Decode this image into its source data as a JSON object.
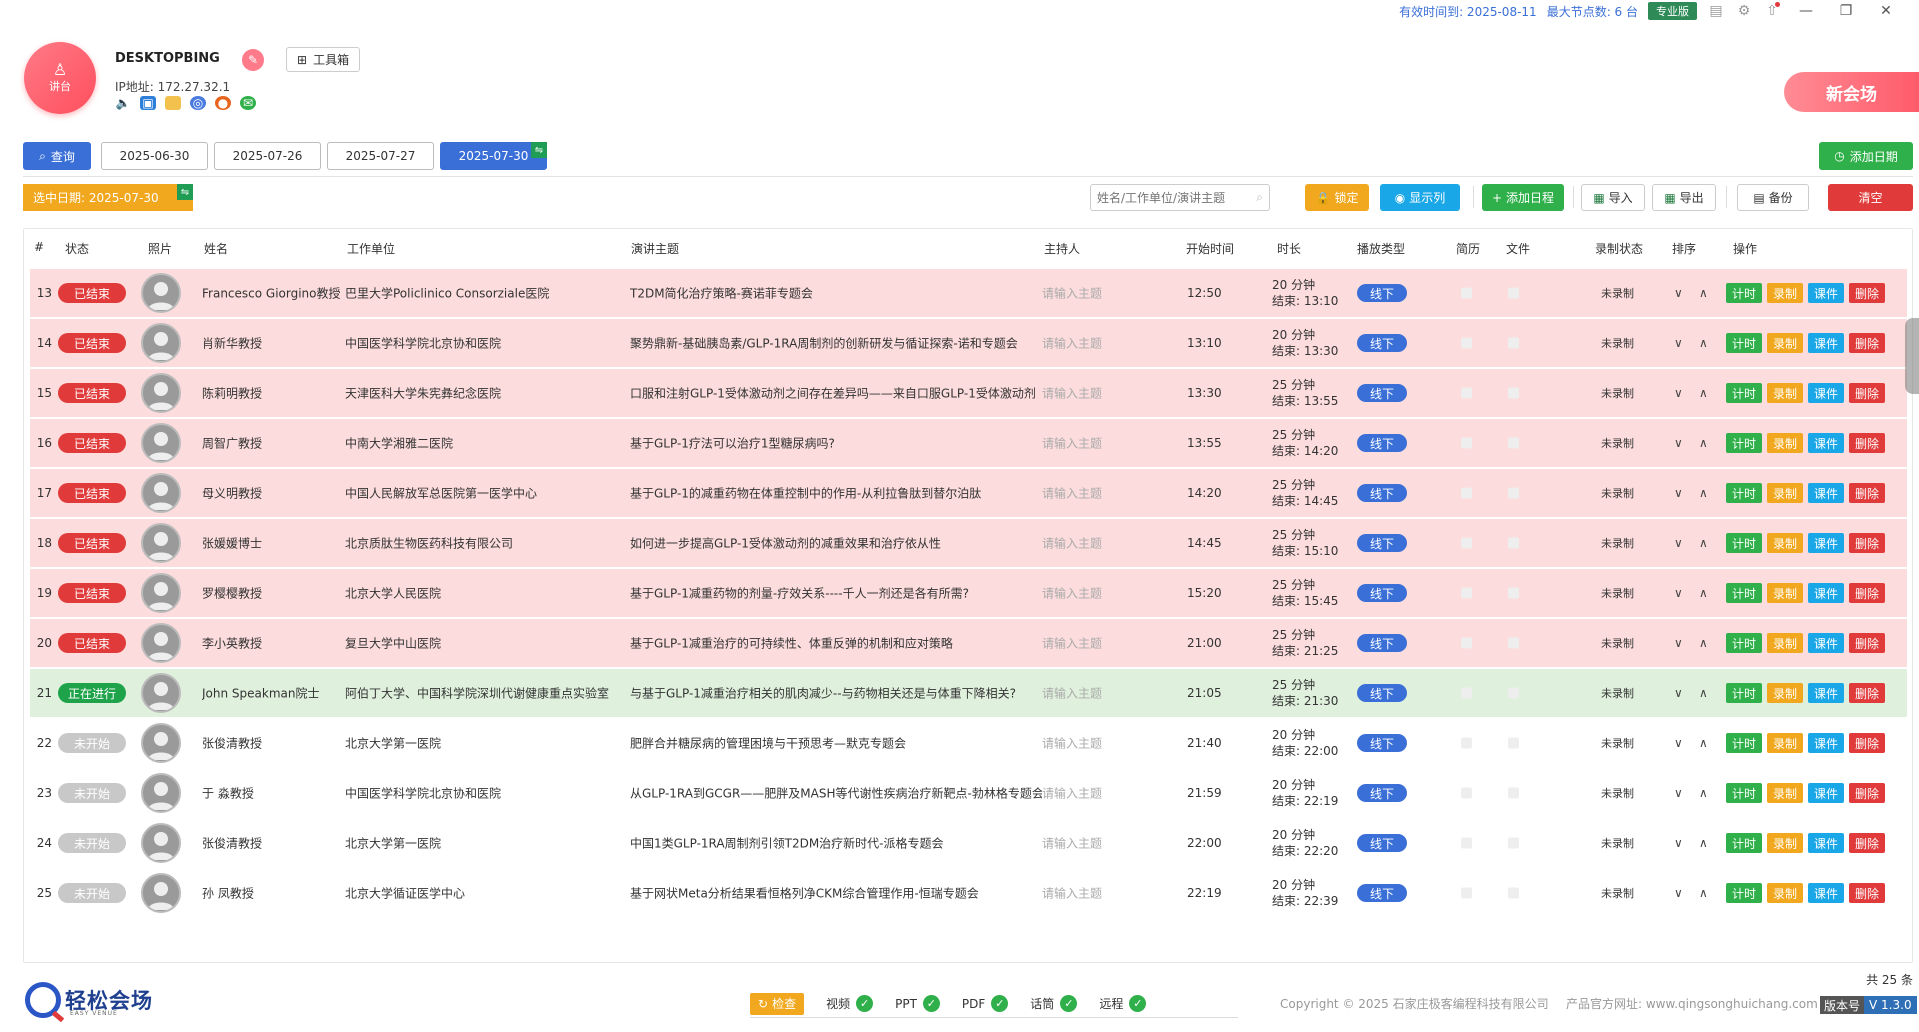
{
  "titlebar": {
    "valid_until": "有效时间到: 2025-08-11",
    "max_nodes": "最大节点数: 6 台",
    "edition": "专业版"
  },
  "header": {
    "avatar_label": "讲台",
    "host_name": "DESKTOPBING",
    "toolbox_label": "工具箱",
    "ip_line": "IP地址: 172.27.32.1",
    "new_venue_label": "新会场"
  },
  "dates": {
    "query_label": "查询",
    "tabs": [
      {
        "label": "2025-06-30"
      },
      {
        "label": "2025-07-26"
      },
      {
        "label": "2025-07-27"
      },
      {
        "label": "2025-07-30"
      }
    ],
    "add_date_label": "添加日期"
  },
  "toolbar": {
    "selected_date": "选中日期:  2025-07-30",
    "search_placeholder": "姓名/工作单位/演讲主题",
    "lock_label": "锁定",
    "display_cols_label": "显示列",
    "add_schedule_label": "添加日程",
    "import_label": "导入",
    "export_label": "导出",
    "backup_label": "备份",
    "clear_label": "清空"
  },
  "table": {
    "headers": {
      "num": "#",
      "status": "状态",
      "photo": "照片",
      "name": "姓名",
      "org": "工作单位",
      "topic": "演讲主题",
      "host": "主持人",
      "start": "开始时间",
      "duration": "时长",
      "play_type": "播放类型",
      "cv": "简历",
      "file": "文件",
      "rec_status": "录制状态",
      "sort": "排序",
      "ops": "操作"
    },
    "host_placeholder": "请输入主题",
    "play_type_label": "线下",
    "rec_status_label": "未录制",
    "op_labels": {
      "timer": "计时",
      "record": "录制",
      "course": "课件",
      "delete": "删除"
    },
    "rows": [
      {
        "num": "13",
        "state": "done",
        "status": "已结束",
        "name": "Francesco Giorgino教授",
        "org": "巴里大学Policlinico Consorziale医院",
        "topic": "T2DM简化治疗策略-赛诺菲专题会",
        "start": "12:50",
        "dur": "20 分钟",
        "end": "结束: 13:10"
      },
      {
        "num": "14",
        "state": "done",
        "status": "已结束",
        "name": "肖新华教授",
        "org": "中国医学科学院北京协和医院",
        "topic": "聚势鼎新-基础胰岛素/GLP-1RA周制剂的创新研发与循证探索-诺和专题会",
        "start": "13:10",
        "dur": "20 分钟",
        "end": "结束: 13:30"
      },
      {
        "num": "15",
        "state": "done",
        "status": "已结束",
        "name": "陈莉明教授",
        "org": "天津医科大学朱宪彝纪念医院",
        "topic": "口服和注射GLP-1受体激动剂之间存在差异吗——来自口服GLP-1受体激动剂",
        "start": "13:30",
        "dur": "25 分钟",
        "end": "结束: 13:55"
      },
      {
        "num": "16",
        "state": "done",
        "status": "已结束",
        "name": "周智广教授",
        "org": "中南大学湘雅二医院",
        "topic": "基于GLP-1疗法可以治疗1型糖尿病吗?",
        "start": "13:55",
        "dur": "25 分钟",
        "end": "结束: 14:20"
      },
      {
        "num": "17",
        "state": "done",
        "status": "已结束",
        "name": "母义明教授",
        "org": "中国人民解放军总医院第一医学中心",
        "topic": "基于GLP-1的减重药物在体重控制中的作用-从利拉鲁肽到替尔泊肽",
        "start": "14:20",
        "dur": "25 分钟",
        "end": "结束: 14:45"
      },
      {
        "num": "18",
        "state": "done",
        "status": "已结束",
        "name": "张媛媛博士",
        "org": "北京质肽生物医药科技有限公司",
        "topic": "如何进一步提高GLP-1受体激动剂的减重效果和治疗依从性",
        "start": "14:45",
        "dur": "25 分钟",
        "end": "结束: 15:10"
      },
      {
        "num": "19",
        "state": "done",
        "status": "已结束",
        "name": "罗樱樱教授",
        "org": "北京大学人民医院",
        "topic": "基于GLP-1减重药物的剂量-疗效关系----千人一剂还是各有所需?",
        "start": "15:20",
        "dur": "25 分钟",
        "end": "结束: 15:45"
      },
      {
        "num": "20",
        "state": "done",
        "status": "已结束",
        "name": "李小英教授",
        "org": "复旦大学中山医院",
        "topic": "基于GLP-1减重治疗的可持续性、体重反弹的机制和应对策略",
        "start": "21:00",
        "dur": "25 分钟",
        "end": "结束: 21:25"
      },
      {
        "num": "21",
        "state": "live",
        "status": "正在进行",
        "name": "John Speakman院士",
        "org": "阿伯丁大学、中国科学院深圳代谢健康重点实验室",
        "topic": "与基于GLP-1减重治疗相关的肌肉减少--与药物相关还是与体重下降相关?",
        "start": "21:05",
        "dur": "25 分钟",
        "end": "结束: 21:30"
      },
      {
        "num": "22",
        "state": "pending",
        "status": "未开始",
        "name": "张俊清教授",
        "org": "北京大学第一医院",
        "topic": "肥胖合并糖尿病的管理困境与干预思考—默克专题会",
        "start": "21:40",
        "dur": "20 分钟",
        "end": "结束: 22:00"
      },
      {
        "num": "23",
        "state": "pending",
        "status": "未开始",
        "name": "于 淼教授",
        "org": "中国医学科学院北京协和医院",
        "topic": "从GLP-1RA到GCGR——肥胖及MASH等代谢性疾病治疗新靶点-勃林格专题会",
        "start": "21:59",
        "dur": "20 分钟",
        "end": "结束: 22:19"
      },
      {
        "num": "24",
        "state": "pending",
        "status": "未开始",
        "name": "张俊清教授",
        "org": "北京大学第一医院",
        "topic": "中国1类GLP-1RA周制剂引领T2DM治疗新时代-派格专题会",
        "start": "22:00",
        "dur": "20 分钟",
        "end": "结束: 22:20"
      },
      {
        "num": "25",
        "state": "pending",
        "status": "未开始",
        "name": "孙 凤教授",
        "org": "北京大学循证医学中心",
        "topic": "基于网状Meta分析结果看恒格列净CKM综合管理作用-恒瑞专题会",
        "start": "22:19",
        "dur": "20 分钟",
        "end": "结束: 22:39"
      }
    ],
    "total": "共 25 条"
  },
  "footer": {
    "brand": "轻松会场",
    "brand_sub": "EASY VENUE",
    "check_label": "检查",
    "checks": [
      {
        "label": "视频"
      },
      {
        "label": "PPT"
      },
      {
        "label": "PDF"
      },
      {
        "label": "话筒"
      },
      {
        "label": "远程"
      }
    ],
    "copyright": "Copyright © 2025 石家庄极客编程科技有限公司",
    "website": "产品官方网址: www.qingsonghuichang.com",
    "version_key": "版本号",
    "version_val": "V 1.3.0"
  }
}
